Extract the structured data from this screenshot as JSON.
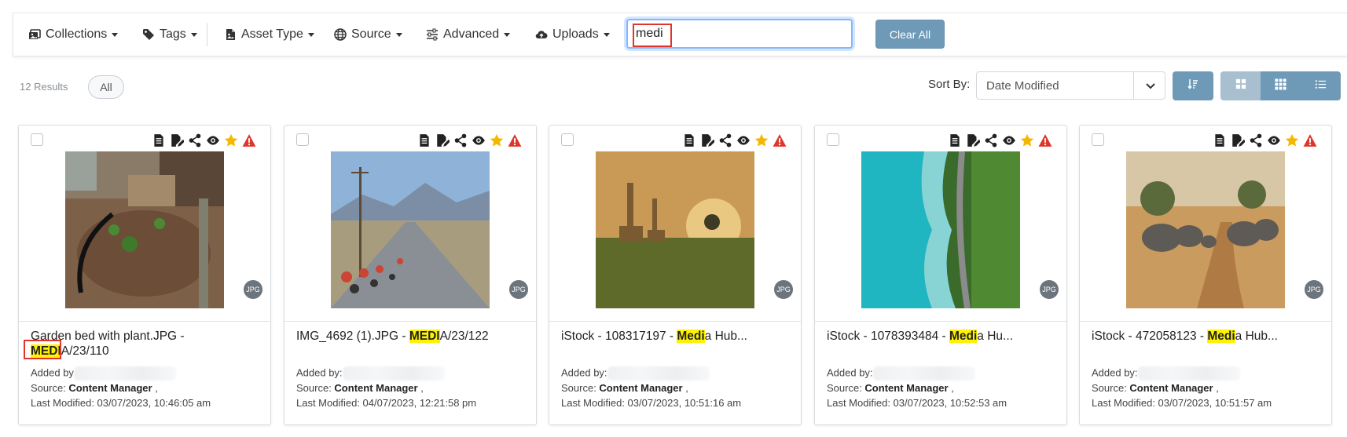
{
  "toolbar": {
    "collections": "Collections",
    "tags": "Tags",
    "asset_type": "Asset Type",
    "source": "Source",
    "advanced": "Advanced",
    "uploads": "Uploads",
    "search_value": "medi",
    "clear_all": "Clear All"
  },
  "results": {
    "count": "12 Results",
    "filter_all": "All"
  },
  "sort": {
    "label": "Sort By:",
    "value": "Date Modified"
  },
  "cards": [
    {
      "title_pre": "Garden bed with plant.JPG - ",
      "title_hl": "MEDI",
      "title_post": "A/23/110",
      "added_by": "Added by",
      "source_label": "Source: ",
      "source_value": "Content Manager",
      "source_tail": " ,",
      "last_modified": "Last Modified: 03/07/2023, 10:46:05 am",
      "badge": "JPG"
    },
    {
      "title_pre": "IMG_4692 (1).JPG - ",
      "title_hl": "MEDI",
      "title_post": "A/23/122",
      "added_by": "Added by:",
      "source_label": "Source: ",
      "source_value": "Content Manager",
      "source_tail": " ,",
      "last_modified": "Last Modified: 04/07/2023, 12:21:58 pm",
      "badge": "JPG"
    },
    {
      "title_pre": "iStock - 108317197 - ",
      "title_hl": "Medi",
      "title_post": "a Hub...",
      "added_by": "Added by:",
      "source_label": "Source: ",
      "source_value": "Content Manager",
      "source_tail": " ,",
      "last_modified": "Last Modified: 03/07/2023, 10:51:16 am",
      "badge": "JPG"
    },
    {
      "title_pre": "iStock - 1078393484 - ",
      "title_hl": "Medi",
      "title_post": "a Hu...",
      "added_by": "Added by:",
      "source_label": "Source: ",
      "source_value": "Content Manager",
      "source_tail": " ,",
      "last_modified": "Last Modified: 03/07/2023, 10:52:53 am",
      "badge": "JPG"
    },
    {
      "title_pre": "iStock - 472058123 - ",
      "title_hl": "Medi",
      "title_post": "a Hub...",
      "added_by": "Added by:",
      "source_label": "Source: ",
      "source_value": "Content Manager",
      "source_tail": " ,",
      "last_modified": "Last Modified: 03/07/2023, 10:51:57 am",
      "badge": "JPG"
    }
  ],
  "colors": {
    "accent": "#6f9ab7",
    "highlight": "#fff200",
    "warning": "#e0352b",
    "star": "#f5b800"
  },
  "icons": {
    "card_actions": [
      "document-icon",
      "edit-document-icon",
      "share-icon",
      "eye-icon",
      "star-icon",
      "warning-icon"
    ]
  }
}
